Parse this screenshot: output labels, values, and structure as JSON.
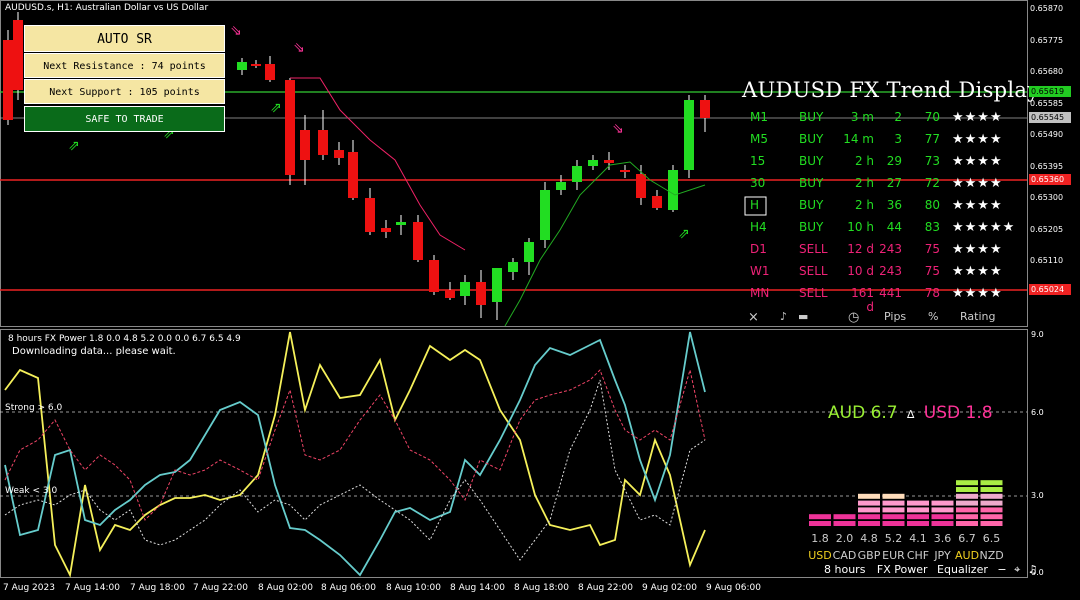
{
  "header": {
    "title": "AUDUSD.s, H1:  Australian Dollar vs US Dollar"
  },
  "auto_sr": {
    "title": "AUTO SR",
    "resistance": "Next Resistance : 74 points",
    "support": "Next Support : 105 points",
    "status": "SAFE TO TRADE"
  },
  "trend_display": {
    "title": "AUDUSD FX Trend Display",
    "rows": [
      {
        "tf": "M1",
        "dir": "BUY",
        "time": "3 m",
        "pips": "2",
        "pct": "70",
        "stars": "★★★★",
        "color": "#22dd22"
      },
      {
        "tf": "M5",
        "dir": "BUY",
        "time": "14 m",
        "pips": "3",
        "pct": "77",
        "stars": "★★★★",
        "color": "#22dd22"
      },
      {
        "tf": "15",
        "dir": "BUY",
        "time": "2 h",
        "pips": "29",
        "pct": "73",
        "stars": "★★★★",
        "color": "#22dd22"
      },
      {
        "tf": "30",
        "dir": "BUY",
        "time": "2 h",
        "pips": "27",
        "pct": "72",
        "stars": "★★★★",
        "color": "#22dd22"
      },
      {
        "tf": "H",
        "dir": "BUY",
        "time": "2 h",
        "pips": "36",
        "pct": "80",
        "stars": "★★★★",
        "color": "#22dd22"
      },
      {
        "tf": "H4",
        "dir": "BUY",
        "time": "10 h",
        "pips": "44",
        "pct": "83",
        "stars": "★★★★★",
        "color": "#22dd22"
      },
      {
        "tf": "D1",
        "dir": "SELL",
        "time": "12 d",
        "pips": "243",
        "pct": "75",
        "stars": "★★★★",
        "color": "#ee2277"
      },
      {
        "tf": "W1",
        "dir": "SELL",
        "time": "10 d",
        "pips": "243",
        "pct": "75",
        "stars": "★★★★",
        "color": "#ee2277"
      },
      {
        "tf": "MN",
        "dir": "SELL",
        "time": "161 d",
        "pips": "441",
        "pct": "78",
        "stars": "★★★★",
        "color": "#ee2277"
      }
    ],
    "footer": {
      "close": "×",
      "sound": "♪",
      "line": "▬",
      "clock": "◷",
      "pips": "Pips",
      "pct": "%",
      "rating": "Rating"
    }
  },
  "price_axis": {
    "labels": [
      "0.65870",
      "0.65775",
      "0.65680",
      "0.65585",
      "0.65490",
      "0.65395",
      "0.65300",
      "0.65205",
      "0.65110",
      "0.65015"
    ],
    "badges": [
      {
        "text": "0.65619",
        "bg": "#22cc22",
        "fg": "#000"
      },
      {
        "text": "0.65545",
        "bg": "#c0c0c0",
        "fg": "#000"
      },
      {
        "text": "0.65360",
        "bg": "#ee2222",
        "fg": "#fff"
      },
      {
        "text": "0.65024",
        "bg": "#ee2222",
        "fg": "#fff"
      }
    ]
  },
  "time_axis": [
    "7 Aug 2023",
    "7 Aug 14:00",
    "7 Aug 18:00",
    "7 Aug 22:00",
    "8 Aug 02:00",
    "8 Aug 06:00",
    "8 Aug 10:00",
    "8 Aug 14:00",
    "8 Aug 18:00",
    "8 Aug 22:00",
    "9 Aug 02:00",
    "9 Aug 06:00"
  ],
  "indicator": {
    "title": "8 hours FX Power 1.8 0.0 4.8 5.2 0.0 0.0 6.7 6.5 4.9",
    "loading": "Downloading data... please wait.",
    "strong_label": "Strong > 6.0",
    "weak_label": "Weak < 3.0",
    "axis": [
      "9.0",
      "6.0",
      "3.0",
      "0.0"
    ],
    "aud_power": "AUD 6.7",
    "delta": "∆",
    "usd_power": "USD 1.8",
    "equalizer": {
      "values": [
        "1.8",
        "2.0",
        "4.8",
        "5.2",
        "4.1",
        "3.6",
        "6.7",
        "6.5"
      ],
      "currencies": [
        "USD",
        "CAD",
        "GBP",
        "EUR",
        "CHF",
        "JPY",
        "AUD",
        "NZD"
      ],
      "levels": [
        1.8,
        2.0,
        4.8,
        5.2,
        4.1,
        3.6,
        6.7,
        6.5
      ],
      "footer": {
        "period": "8 hours",
        "fx": "FX Power",
        "eq": "Equalizer",
        "minus": "−",
        "crosshair": "⌖",
        "note": "♫"
      }
    }
  },
  "colors": {
    "bull": "#22dd22",
    "bear": "#ee1111",
    "resistance_line": "#ee2222",
    "support_line": "#33cc33",
    "aud_color": "#99ee33",
    "usd_color": "#ff3399"
  }
}
